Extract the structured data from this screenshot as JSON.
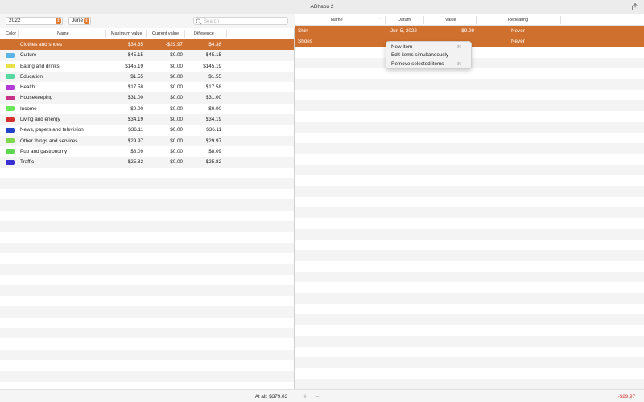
{
  "app": {
    "title": "ADhabu 2"
  },
  "toolbar": {
    "year": "2022",
    "month": "June",
    "search_placeholder": "Search"
  },
  "left_table": {
    "headers": {
      "color": "Color",
      "name": "Name",
      "max": "Maximum value",
      "current": "Current value",
      "diff": "Difference"
    },
    "rows": [
      {
        "color": "#d0702f",
        "name": "Clothes and shoes",
        "max": "$34.35",
        "current": "-$29.97",
        "diff": "$4.38",
        "selected": true
      },
      {
        "color": "#5ab4e6",
        "name": "Culture",
        "max": "$45.15",
        "current": "$0.00",
        "diff": "$45.15"
      },
      {
        "color": "#e8e046",
        "name": "Eating and drinks",
        "max": "$145.19",
        "current": "$0.00",
        "diff": "$145.19"
      },
      {
        "color": "#56d9a0",
        "name": "Education",
        "max": "$1.55",
        "current": "$0.00",
        "diff": "$1.55"
      },
      {
        "color": "#b63ad8",
        "name": "Health",
        "max": "$17.58",
        "current": "$0.00",
        "diff": "$17.58"
      },
      {
        "color": "#c8338a",
        "name": "Housekeeping",
        "max": "$31.00",
        "current": "$0.00",
        "diff": "$31.00"
      },
      {
        "color": "#6be85a",
        "name": "Income",
        "max": "$0.00",
        "current": "$0.00",
        "diff": "$0.00"
      },
      {
        "color": "#d4302e",
        "name": "Living and energy",
        "max": "$34.19",
        "current": "$0.00",
        "diff": "$34.19"
      },
      {
        "color": "#2243c8",
        "name": "News, papers and television",
        "max": "$36.11",
        "current": "$0.00",
        "diff": "$36.11"
      },
      {
        "color": "#7fd84a",
        "name": "Other things and services",
        "max": "$29.97",
        "current": "$0.00",
        "diff": "$29.97"
      },
      {
        "color": "#5ed84f",
        "name": "Pub and gastronomy",
        "max": "$8.09",
        "current": "$0.00",
        "diff": "$8.09"
      },
      {
        "color": "#3a2fd0",
        "name": "Traffic",
        "max": "$25.82",
        "current": "$0.00",
        "diff": "$25.82"
      }
    ],
    "footer": "At all: $379.03"
  },
  "right_table": {
    "headers": {
      "name": "Name",
      "date": "Datum",
      "value": "Value",
      "repeating": "Repeating"
    },
    "rows": [
      {
        "name": "Shirt",
        "date": "Jun 5, 2022",
        "value": "-$9.99",
        "repeating": "Never"
      },
      {
        "name": "Shoes",
        "date": "",
        "value": "",
        "repeating": "Never"
      }
    ],
    "footer_total": "-$29.97",
    "add_label": "+",
    "remove_label": "−"
  },
  "context_menu": {
    "items": [
      {
        "label": "New item",
        "shortcut": "⌘ +"
      },
      {
        "label": "Edit items simultaneously",
        "shortcut": ""
      },
      {
        "label": "Remove selected items",
        "shortcut": "⌘ −"
      }
    ]
  }
}
